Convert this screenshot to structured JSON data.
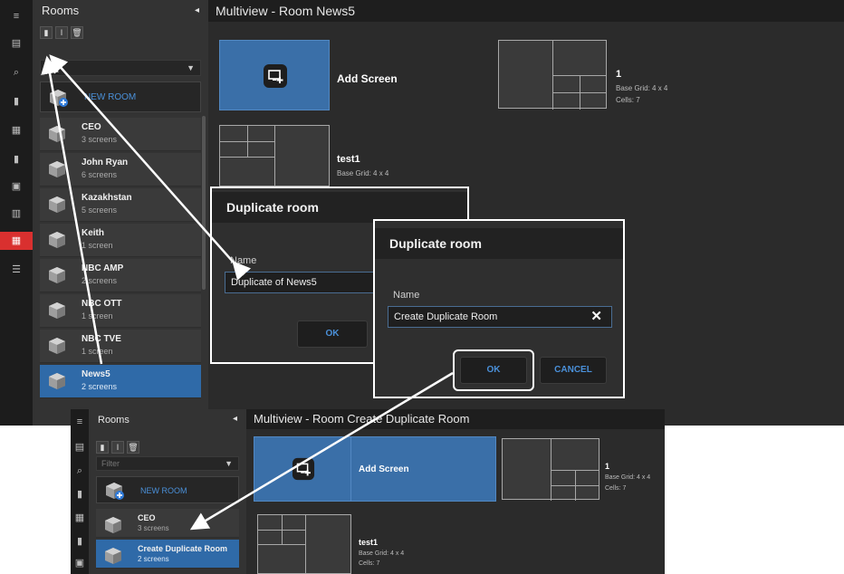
{
  "top": {
    "sidebar_title": "Rooms",
    "main_title": "Multiview - Room News5",
    "filter_placeholder": "",
    "new_room_label": "NEW ROOM",
    "rooms": [
      {
        "name": "CEO",
        "sub": "3 screens"
      },
      {
        "name": "John Ryan",
        "sub": "6 screens"
      },
      {
        "name": "Kazakhstan",
        "sub": "5 screens"
      },
      {
        "name": "Keith",
        "sub": "1 screen"
      },
      {
        "name": "NBC AMP",
        "sub": "2 screens"
      },
      {
        "name": "NBC OTT",
        "sub": "1 screen"
      },
      {
        "name": "NBC TVE",
        "sub": "1 screen"
      },
      {
        "name": "News5",
        "sub": "2 screens"
      }
    ],
    "tiles": {
      "add_screen": "Add Screen",
      "screen1_name": "1",
      "screen1_grid": "Base Grid: 4 x 4",
      "screen1_cells": "Cells: 7",
      "screen2_name": "test1",
      "screen2_grid": "Base Grid: 4 x 4"
    }
  },
  "dialog1": {
    "title": "Duplicate room",
    "name_label": "Name",
    "name_value": "Duplicate of News5",
    "ok": "OK"
  },
  "dialog2": {
    "title": "Duplicate room",
    "name_label": "Name",
    "name_value": "Create Duplicate Room",
    "clear_glyph": "✕",
    "ok": "OK",
    "cancel": "CANCEL"
  },
  "bottom": {
    "sidebar_title": "Rooms",
    "main_title": "Multiview - Room Create Duplicate Room",
    "filter_placeholder": "Filter",
    "new_room_label": "NEW ROOM",
    "rooms": [
      {
        "name": "CEO",
        "sub": "3 screens"
      },
      {
        "name": "Create Duplicate Room",
        "sub": "2 screens"
      }
    ],
    "tiles": {
      "add_screen": "Add Screen",
      "screen1_name": "1",
      "screen1_grid": "Base Grid: 4 x 4",
      "screen1_cells": "Cells: 7",
      "screen2_name": "test1",
      "screen2_grid": "Base Grid: 4 x 4",
      "screen2_cells": "Cells: 7"
    }
  },
  "icons": {
    "menu": "≡",
    "film": "▤",
    "search": "⌕",
    "bookmark": "▮",
    "table": "▦",
    "doc": "▮",
    "grid": "▣",
    "panel": "▥",
    "multiview": "▦",
    "list": "☰",
    "collapse": "◂",
    "filter": "▼",
    "copy": "▮",
    "rename": "I",
    "delete": "🗑"
  },
  "colors": {
    "accent_blue": "#4a90d9",
    "selected_room": "#2f6aa8",
    "active_rail": "#d9302f"
  }
}
